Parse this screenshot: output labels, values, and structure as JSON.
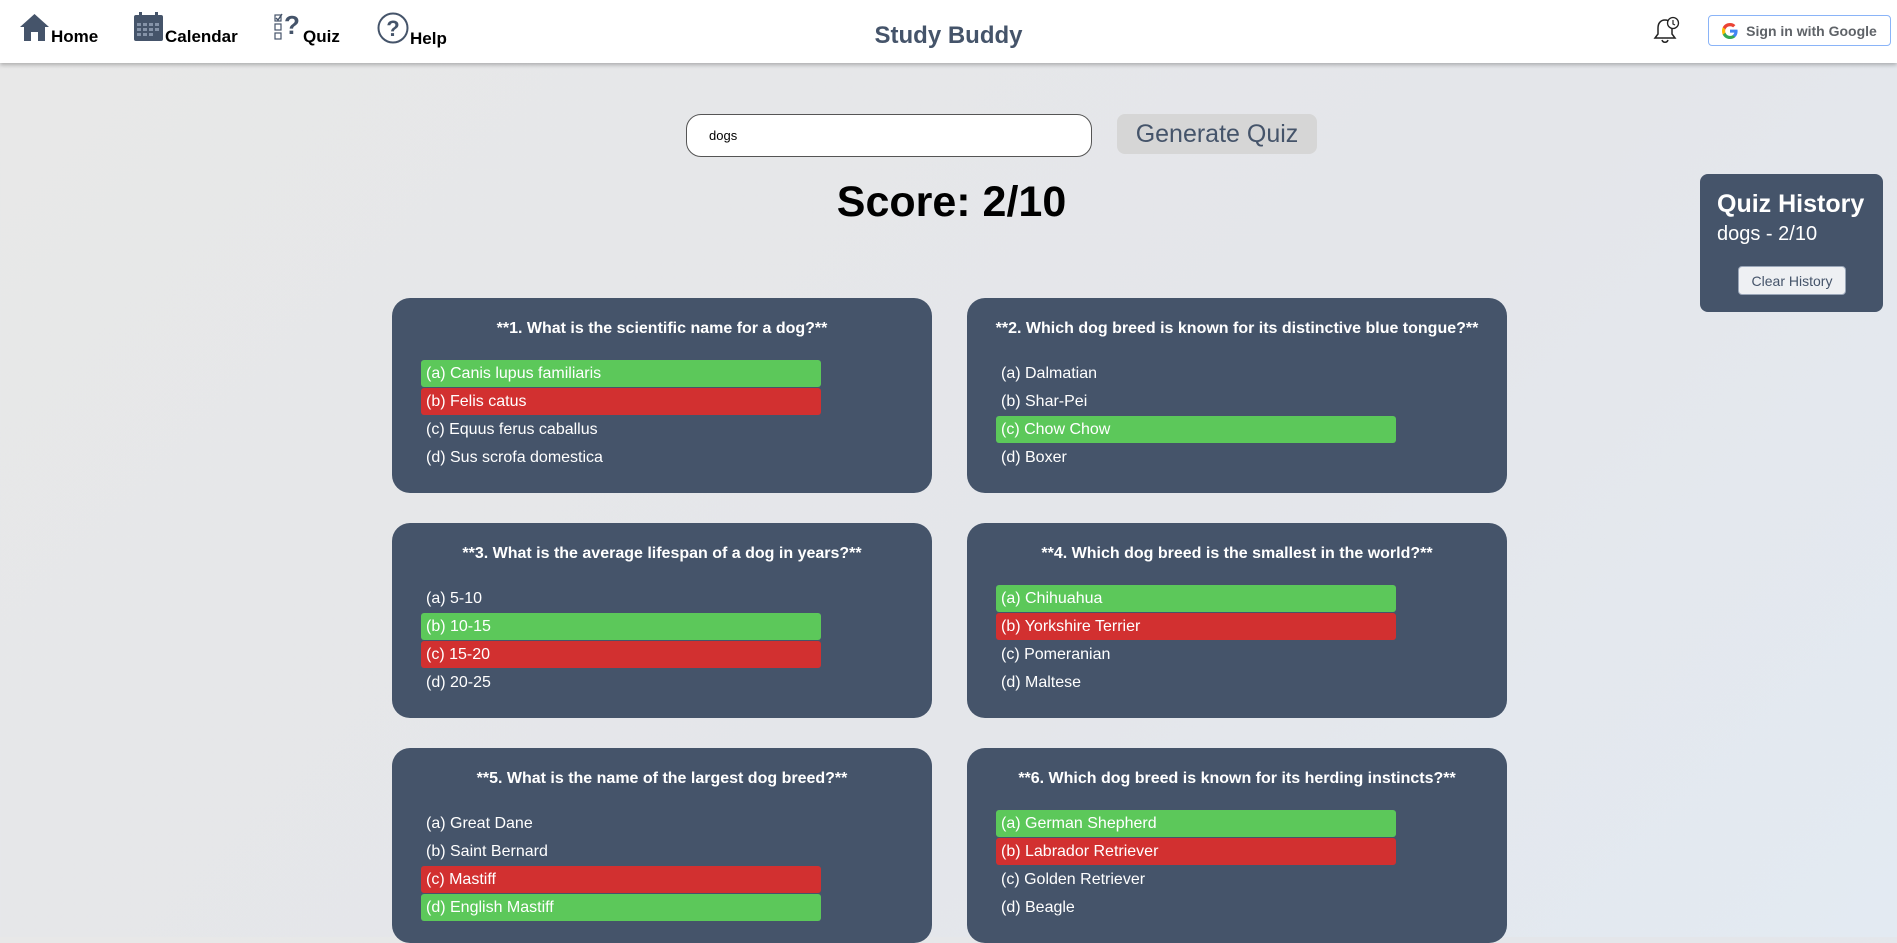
{
  "nav": {
    "home": "Home",
    "calendar": "Calendar",
    "quiz": "Quiz",
    "help": "Help"
  },
  "app_title": "Study Buddy",
  "auth": {
    "google_label": "Sign in with Google"
  },
  "search": {
    "value": "dogs"
  },
  "generate_label": "Generate Quiz",
  "score": "Score: 2/10",
  "history": {
    "title": "Quiz History",
    "entry": "dogs - 2/10",
    "clear_label": "Clear History"
  },
  "colors": {
    "card": "#45546a",
    "correct": "#5cc85a",
    "wrong": "#d23030",
    "title": "#45546a"
  },
  "questions": [
    {
      "text": "**1. What is the scientific name for a dog?**",
      "options": [
        {
          "text": "(a) Canis lupus familiaris",
          "state": "correct"
        },
        {
          "text": "(b) Felis catus",
          "state": "wrong"
        },
        {
          "text": "(c) Equus ferus caballus",
          "state": ""
        },
        {
          "text": "(d) Sus scrofa domestica",
          "state": ""
        }
      ]
    },
    {
      "text": "**2. Which dog breed is known for its distinctive blue tongue?**",
      "options": [
        {
          "text": "(a) Dalmatian",
          "state": ""
        },
        {
          "text": "(b) Shar-Pei",
          "state": ""
        },
        {
          "text": "(c) Chow Chow",
          "state": "correct"
        },
        {
          "text": "(d) Boxer",
          "state": ""
        }
      ]
    },
    {
      "text": "**3. What is the average lifespan of a dog in years?**",
      "options": [
        {
          "text": "(a) 5-10",
          "state": ""
        },
        {
          "text": "(b) 10-15",
          "state": "correct"
        },
        {
          "text": "(c) 15-20",
          "state": "wrong"
        },
        {
          "text": "(d) 20-25",
          "state": ""
        }
      ]
    },
    {
      "text": "**4. Which dog breed is the smallest in the world?**",
      "options": [
        {
          "text": "(a) Chihuahua",
          "state": "correct"
        },
        {
          "text": "(b) Yorkshire Terrier",
          "state": "wrong"
        },
        {
          "text": "(c) Pomeranian",
          "state": ""
        },
        {
          "text": "(d) Maltese",
          "state": ""
        }
      ]
    },
    {
      "text": "**5. What is the name of the largest dog breed?**",
      "options": [
        {
          "text": "(a) Great Dane",
          "state": ""
        },
        {
          "text": "(b) Saint Bernard",
          "state": ""
        },
        {
          "text": "(c) Mastiff",
          "state": "wrong"
        },
        {
          "text": "(d) English Mastiff",
          "state": "correct"
        }
      ]
    },
    {
      "text": "**6. Which dog breed is known for its herding instincts?**",
      "options": [
        {
          "text": "(a) German Shepherd",
          "state": "correct"
        },
        {
          "text": "(b) Labrador Retriever",
          "state": "wrong"
        },
        {
          "text": "(c) Golden Retriever",
          "state": ""
        },
        {
          "text": "(d) Beagle",
          "state": ""
        }
      ]
    }
  ]
}
